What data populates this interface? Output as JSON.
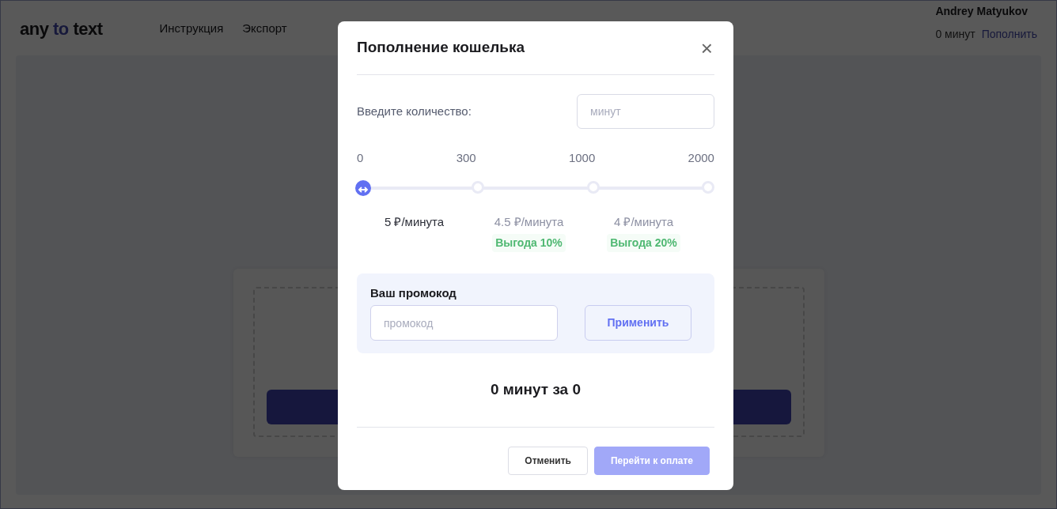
{
  "navbar": {
    "logo": [
      {
        "text": "any ",
        "accent": false
      },
      {
        "text": "to",
        "accent": true
      },
      {
        "text": " text",
        "accent": false
      }
    ],
    "links": [
      "Инструкция",
      "Экспорт"
    ],
    "user": {
      "name": "Andrey Matyukov",
      "balance": "0 минут",
      "topup": "Пополнить"
    }
  },
  "modal": {
    "title": "Пополнение кошелька",
    "close": "×",
    "amount": {
      "label": "Введите количество:",
      "placeholder": "минут"
    },
    "slider": {
      "level": 0,
      "ticks": [
        "0",
        "300",
        "1000",
        "2000"
      ]
    },
    "tiers": [
      {
        "price": "5 ₽/минута",
        "selected": true
      },
      {
        "price": "4.5 ₽/минута",
        "discount": "Выгода 10%",
        "selected": false
      },
      {
        "price": "4 ₽/минута",
        "discount": "Выгода 20%",
        "selected": false
      }
    ],
    "promo": {
      "label": "Ваш промокод",
      "placeholder": "промокод",
      "button": "Применить"
    },
    "total": "0 минут за 0",
    "buttons": [
      {
        "label": "Отменить",
        "kind": "secondary",
        "disabled": false
      },
      {
        "label": "Перейти к оплате",
        "kind": "primary",
        "disabled": true
      }
    ]
  }
}
